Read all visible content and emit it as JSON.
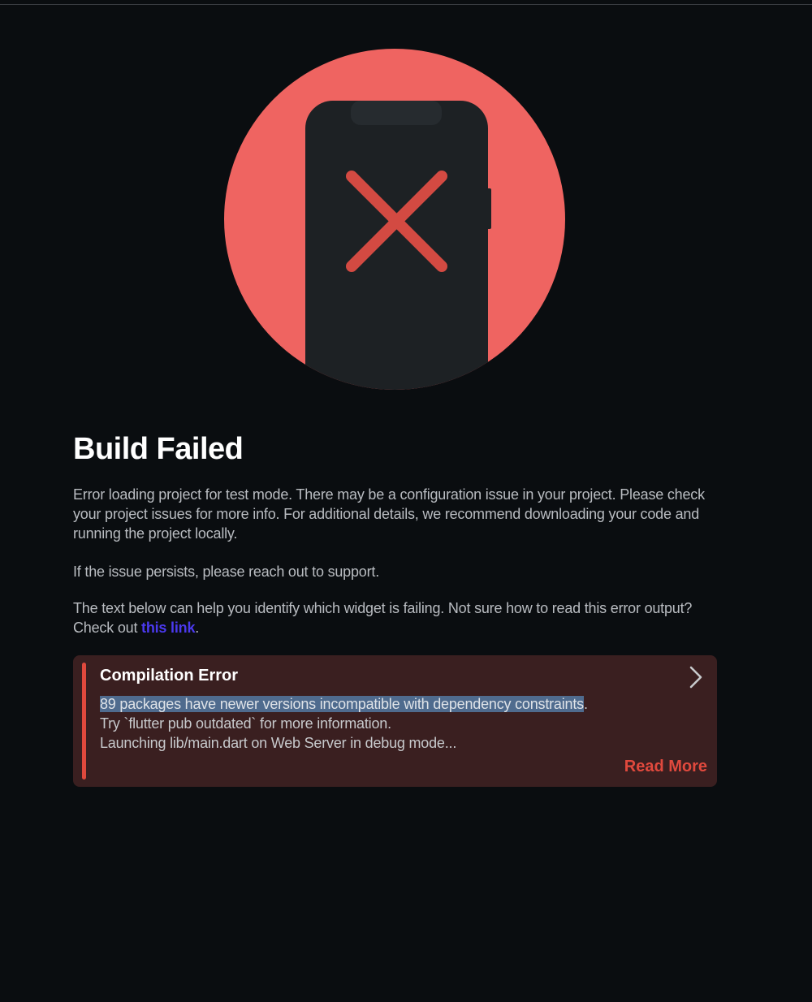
{
  "page": {
    "title": "Build Failed",
    "paragraph_1": "Error loading project for test mode. There may be a configuration issue in your project. Please check your project issues for more info. For additional details, we recommend downloading your code and running the project locally.",
    "paragraph_2": "If the issue persists, please reach out to support.",
    "paragraph_3_prefix": "The text below can help you identify which widget is failing. Not sure how to read this error output? Check out ",
    "paragraph_3_link": "this link",
    "paragraph_3_suffix": "."
  },
  "illustration": {
    "icon": "phone-error-icon",
    "circle_color": "#ef6461",
    "phone_color": "#1d2124",
    "x_color": "#d34a42"
  },
  "error_card": {
    "title": "Compilation Error",
    "lines": [
      "89 packages have newer versions incompatible with dependency constraints.",
      "Try `flutter pub outdated` for more information.",
      "Launching lib/main.dart on Web Server in debug mode..."
    ],
    "highlighted_text": "89 packages have newer versions incompatible with dependency constraints",
    "read_more_label": "Read More",
    "expand_icon": "chevron-right-icon"
  },
  "colors": {
    "background": "#0a0d10",
    "link": "#4b39ef",
    "error_accent": "#e0493d",
    "card_background": "#3a1f20"
  }
}
